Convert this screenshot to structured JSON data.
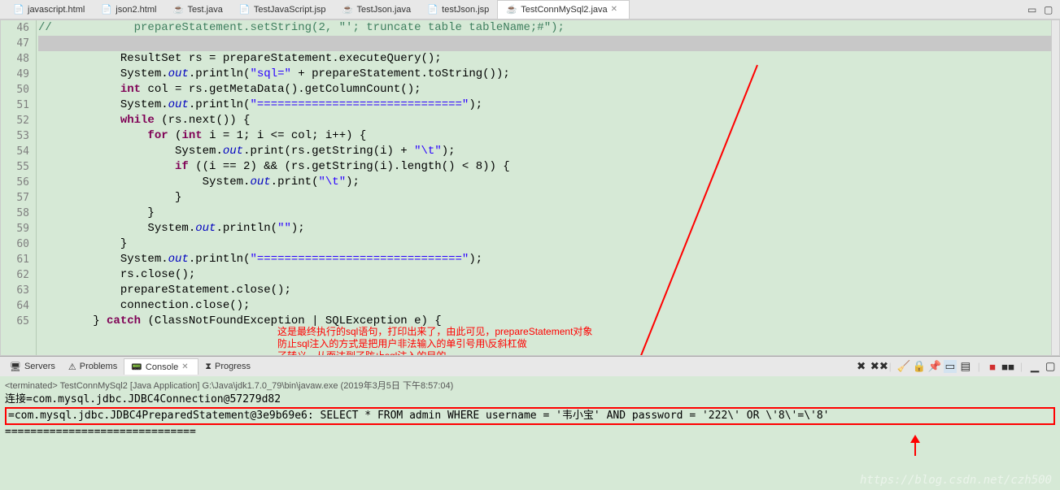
{
  "tabs": [
    {
      "label": "javascript.html",
      "icon": "html"
    },
    {
      "label": "json2.html",
      "icon": "html"
    },
    {
      "label": "Test.java",
      "icon": "java"
    },
    {
      "label": "TestJavaScript.jsp",
      "icon": "jsp"
    },
    {
      "label": "TestJson.java",
      "icon": "java"
    },
    {
      "label": "testJson.jsp",
      "icon": "jsp"
    },
    {
      "label": "TestConnMySql2.java",
      "icon": "java",
      "active": true
    }
  ],
  "lines": {
    "start": 46,
    "end": 65
  },
  "code": {
    "l46": "//            prepareStatement.setString(2, \"'; truncate table tableName;#\");",
    "l48a": "ResultSet rs = prepareStatement.executeQuery();",
    "l49a": "System.",
    "l49b": "out",
    "l49c": ".println(",
    "l49d": "\"sql=\"",
    "l49e": " + prepareStatement.toString());",
    "l50a": "int",
    "l50b": " col = rs.getMetaData().getColumnCount();",
    "l51a": "System.",
    "l51b": "out",
    "l51c": ".println(",
    "l51d": "\"==============================\"",
    "l51e": ");",
    "l52a": "while",
    "l52b": " (rs.next()) {",
    "l53a": "for",
    "l53b": " (",
    "l53c": "int",
    "l53d": " i = 1; i <= col; i++) {",
    "l54a": "System.",
    "l54b": "out",
    "l54c": ".print(rs.getString(i) + ",
    "l54d": "\"\\t\"",
    "l54e": ");",
    "l55a": "if",
    "l55b": " ((i == 2) && (rs.getString(i).length() < 8)) {",
    "l56a": "System.",
    "l56b": "out",
    "l56c": ".print(",
    "l56d": "\"\\t\"",
    "l56e": ");",
    "l57": "}",
    "l58": "}",
    "l59a": "System.",
    "l59b": "out",
    "l59c": ".println(",
    "l59d": "\"\"",
    "l59e": ");",
    "l60": "}",
    "l61a": "System.",
    "l61b": "out",
    "l61c": ".println(",
    "l61d": "\"==============================\"",
    "l61e": ");",
    "l62": "rs.close();",
    "l63": "prepareStatement.close();",
    "l64": "connection.close();",
    "l65a": "} ",
    "l65b": "catch",
    "l65c": " (ClassNotFoundException | SQLException e) {"
  },
  "bottom_tabs": {
    "servers": "Servers",
    "problems": "Problems",
    "console": "Console",
    "progress": "Progress"
  },
  "annotation": {
    "l1": "这是最终执行的sql语句，打印出来了，由此可见，prepareStatement对象",
    "l2": "防止sql注入的方式是把用户非法输入的单引号用\\反斜杠做",
    "l3": "了转义，从而达到了防止sql注入的目的"
  },
  "console": {
    "terminated": "<terminated> TestConnMySql2 [Java Application] G:\\Java\\jdk1.7.0_79\\bin\\javaw.exe (2019年3月5日 下午8:57:04)",
    "line1": "连接=com.mysql.jdbc.JDBC4Connection@57279d82",
    "line2": "=com.mysql.jdbc.JDBC4PreparedStatement@3e9b69e6: SELECT * FROM admin WHERE username = '韦小宝' AND password = '222\\' OR \\'8\\'=\\'8'",
    "line3": "=============================="
  },
  "watermark": "https://blog.csdn.net/czh500"
}
